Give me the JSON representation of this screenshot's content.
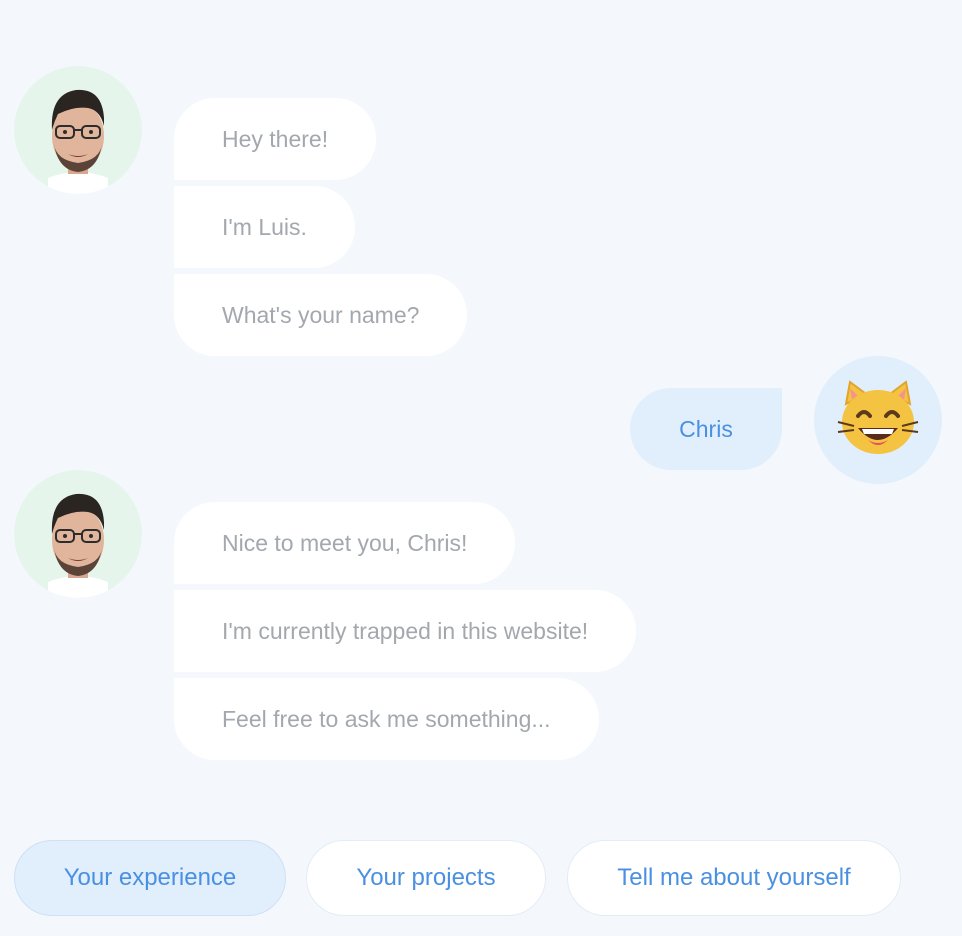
{
  "conversation": {
    "luis_block_1": [
      "Hey there!",
      "I'm Luis.",
      "What's your name?"
    ],
    "user_reply": "Chris",
    "luis_block_2": [
      "Nice to meet you, Chris!",
      "I'm currently trapped in this website!",
      "Feel free to ask me something..."
    ]
  },
  "avatars": {
    "bot": "luis-portrait",
    "user": "grinning-cat-emoji",
    "user_emoji": "😸"
  },
  "options": [
    "Your experience",
    "Your projects",
    "Tell me about yourself"
  ],
  "colors": {
    "background": "#f4f8fd",
    "bot_bubble": "#ffffff",
    "bot_text": "#a3a8ae",
    "user_bubble": "#e1eefc",
    "accent": "#4a90e2",
    "bot_avatar_bg": "#e6f5ec"
  }
}
